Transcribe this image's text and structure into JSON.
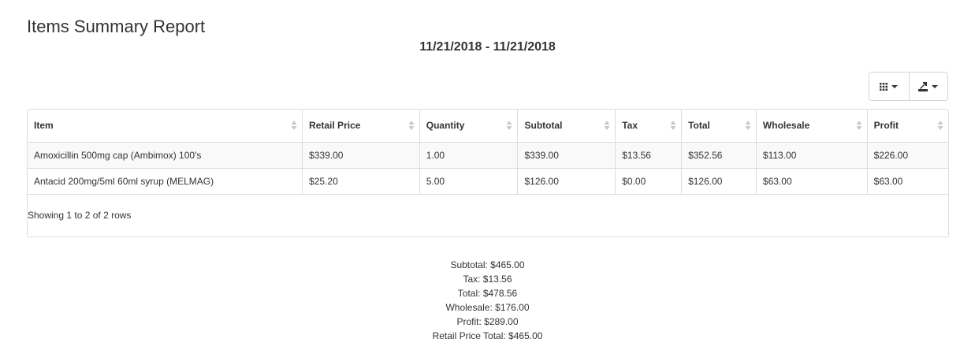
{
  "report": {
    "title": "Items Summary Report",
    "date_range": "11/21/2018 - 11/21/2018"
  },
  "toolbar": {
    "columns_icon": "columns-grid-icon",
    "export_icon": "export-icon"
  },
  "table": {
    "columns": [
      "Item",
      "Retail Price",
      "Quantity",
      "Subtotal",
      "Tax",
      "Total",
      "Wholesale",
      "Profit"
    ],
    "rows": [
      [
        "Amoxicillin 500mg cap (Ambimox) 100's",
        "$339.00",
        "1.00",
        "$339.00",
        "$13.56",
        "$352.56",
        "$113.00",
        "$226.00"
      ],
      [
        "Antacid 200mg/5ml 60ml syrup (MELMAG)",
        "$25.20",
        "5.00",
        "$126.00",
        "$0.00",
        "$126.00",
        "$63.00",
        "$63.00"
      ]
    ],
    "pagination_text": "Showing 1 to 2 of 2 rows"
  },
  "totals": {
    "subtotal": "Subtotal: $465.00",
    "tax": "Tax: $13.56",
    "total": "Total: $478.56",
    "wholesale": "Wholesale: $176.00",
    "profit": "Profit: $289.00",
    "retail_price_total": "Retail Price Total: $465.00"
  }
}
